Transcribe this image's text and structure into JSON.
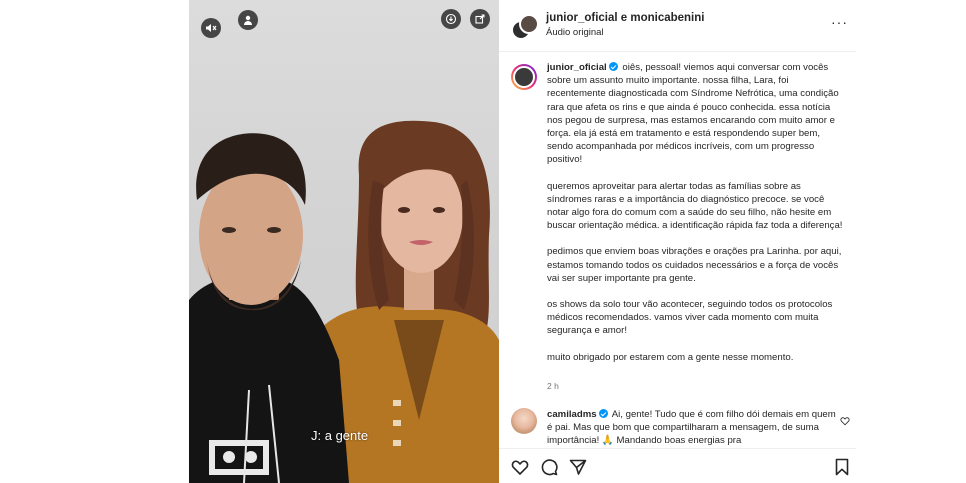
{
  "video": {
    "caption": "J: a gente",
    "controls": {
      "mute_icon": "speaker-muted-icon",
      "tags_icon": "user-icon",
      "save_icon": "download-icon",
      "share_icon": "share-icon"
    }
  },
  "header": {
    "users": "junior_oficial e monicabenini",
    "audio": "Áudio original",
    "more": "···"
  },
  "post": {
    "username": "junior_oficial",
    "paragraphs": [
      "oiês, pessoal! viemos aqui conversar com vocês sobre um assunto muito importante. nossa filha, Lara, foi recentemente diagnosticada com Síndrome Nefrótica, uma condição rara que afeta os rins e que ainda é pouco conhecida. essa notícia nos pegou de surpresa, mas estamos encarando com muito amor e força. ela já está em tratamento e está respondendo super bem, sendo acompanhada por médicos incríveis, com um progresso positivo!",
      "queremos aproveitar para alertar todas as famílias sobre as síndromes raras e a importância do diagnóstico precoce. se você notar algo fora do comum com a saúde do seu filho, não hesite em buscar orientação médica. a identificação rápida faz toda a diferença!",
      "pedimos que enviem boas vibrações e orações pra Larinha. por aqui, estamos tomando todos os cuidados necessários e a força de vocês vai ser super importante pra gente.",
      "os shows da solo tour vão acontecer, seguindo todos os protocolos médicos recomendados. vamos viver cada momento com muita segurança e amor!",
      "muito obrigado por estarem com a gente nesse momento."
    ],
    "time": "2 h"
  },
  "comment": {
    "username": "camiladms",
    "text": "Ai, gente! Tudo que é com filho dói demais em quem é pai. Mas que bom que compartilharam a mensagem, de suma importância! 🙏 Mandando boas energias pra"
  },
  "actions": {
    "like_icon": "heart-icon",
    "comment_icon": "comment-icon",
    "share_icon": "send-icon",
    "save_icon": "bookmark-icon"
  },
  "colors": {
    "verified": "#0095f6",
    "text": "#262626",
    "muted": "#737373"
  }
}
